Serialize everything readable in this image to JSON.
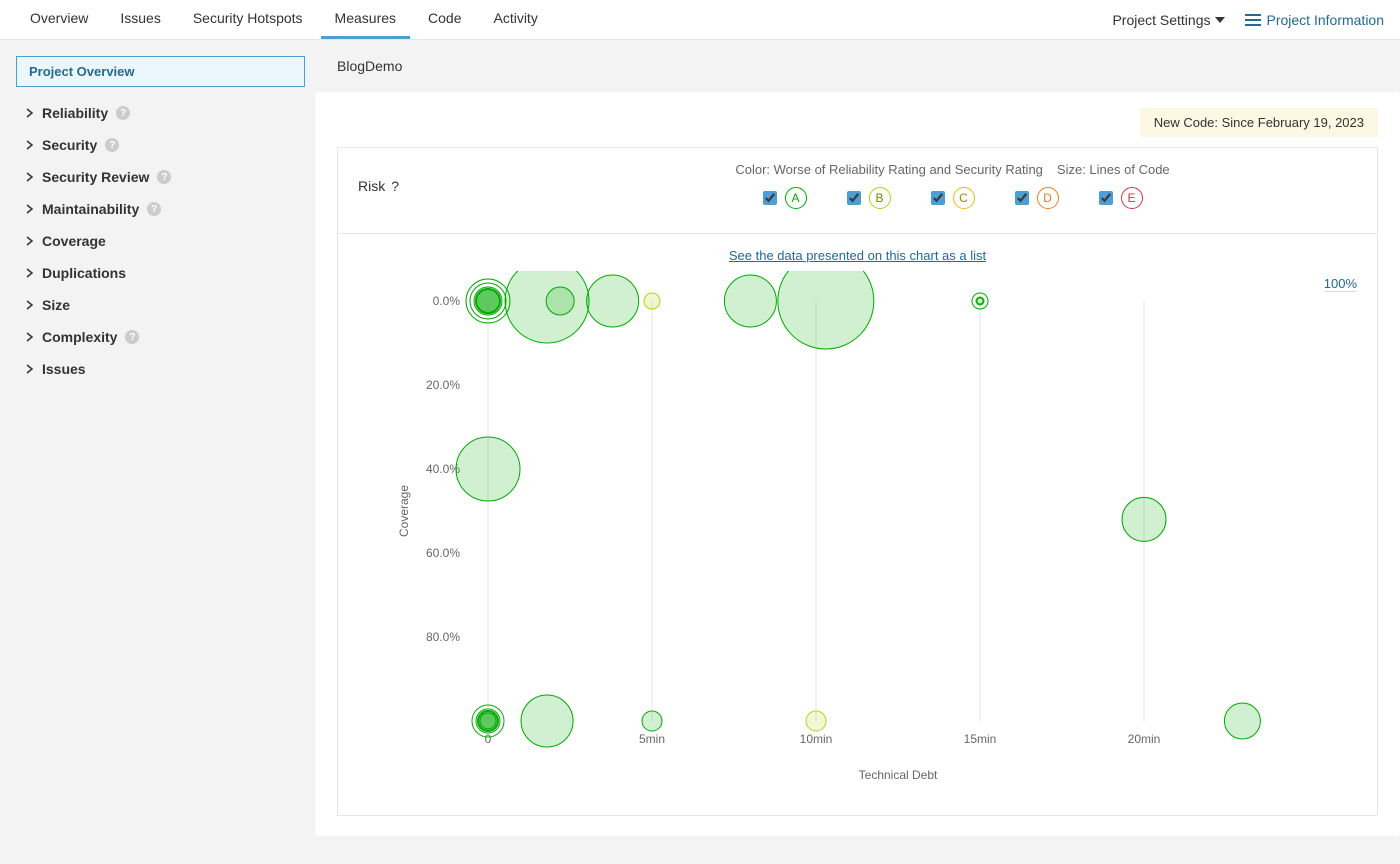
{
  "nav": {
    "tabs": [
      "Overview",
      "Issues",
      "Security Hotspots",
      "Measures",
      "Code",
      "Activity"
    ],
    "active_tab": "Measures",
    "project_settings": "Project Settings",
    "project_info": "Project Information"
  },
  "sidebar": {
    "active": "Project Overview",
    "items": [
      {
        "label": "Reliability",
        "help": true
      },
      {
        "label": "Security",
        "help": true
      },
      {
        "label": "Security Review",
        "help": true
      },
      {
        "label": "Maintainability",
        "help": true
      },
      {
        "label": "Coverage",
        "help": false
      },
      {
        "label": "Duplications",
        "help": false
      },
      {
        "label": "Size",
        "help": false
      },
      {
        "label": "Complexity",
        "help": true
      },
      {
        "label": "Issues",
        "help": false
      }
    ]
  },
  "breadcrumb": "BlogDemo",
  "newcode_banner": "New Code: Since February 19, 2023",
  "legend": {
    "risk_label": "Risk",
    "color_label": "Color: Worse of Reliability Rating and Security Rating",
    "size_label": "Size: Lines of Code",
    "ratings": [
      "A",
      "B",
      "C",
      "D",
      "E"
    ]
  },
  "chart_link": "See the data presented on this chart as a list",
  "zoom": "100%",
  "chart_data": {
    "type": "scatter",
    "title": "Risk",
    "xlabel": "Technical Debt",
    "ylabel": "Coverage",
    "x_ticks": [
      "0",
      "5min",
      "10min",
      "15min",
      "20min"
    ],
    "x_tick_minutes": [
      0,
      5,
      10,
      15,
      20
    ],
    "y_ticks": [
      "0.0%",
      "20.0%",
      "40.0%",
      "60.0%",
      "80.0%"
    ],
    "y_tick_values": [
      0,
      20,
      40,
      60,
      80
    ],
    "size_encoding": "Lines of Code",
    "color_encoding": "Worse of Reliability Rating and Security Rating",
    "bubbles": [
      {
        "x_min": 0,
        "coverage_pct": 0,
        "rating": "A",
        "size": 12,
        "style": "solid"
      },
      {
        "x_min": 0,
        "coverage_pct": 0,
        "rating": "A",
        "size": 22,
        "style": "ring"
      },
      {
        "x_min": 1.8,
        "coverage_pct": 0,
        "rating": "A",
        "size": 42
      },
      {
        "x_min": 2.2,
        "coverage_pct": 0,
        "rating": "A",
        "size": 14
      },
      {
        "x_min": 3.8,
        "coverage_pct": 0,
        "rating": "A",
        "size": 26
      },
      {
        "x_min": 5.0,
        "coverage_pct": 0,
        "rating": "B",
        "size": 8
      },
      {
        "x_min": 8.0,
        "coverage_pct": 0,
        "rating": "A",
        "size": 26
      },
      {
        "x_min": 10.3,
        "coverage_pct": 0,
        "rating": "A",
        "size": 48
      },
      {
        "x_min": 15.0,
        "coverage_pct": 0,
        "rating": "A",
        "size": 8,
        "style": "ring"
      },
      {
        "x_min": 0,
        "coverage_pct": 40,
        "rating": "A",
        "size": 32
      },
      {
        "x_min": 20.0,
        "coverage_pct": 52,
        "rating": "A",
        "size": 22
      },
      {
        "x_min": 0,
        "coverage_pct": 100,
        "rating": "A",
        "size": 16,
        "style": "ring"
      },
      {
        "x_min": 0,
        "coverage_pct": 100,
        "rating": "A",
        "size": 10,
        "style": "solid"
      },
      {
        "x_min": 1.8,
        "coverage_pct": 100,
        "rating": "A",
        "size": 26
      },
      {
        "x_min": 5.0,
        "coverage_pct": 100,
        "rating": "A",
        "size": 10
      },
      {
        "x_min": 10.0,
        "coverage_pct": 100,
        "rating": "B",
        "size": 10
      },
      {
        "x_min": 23.0,
        "coverage_pct": 100,
        "rating": "A",
        "size": 18
      }
    ]
  }
}
